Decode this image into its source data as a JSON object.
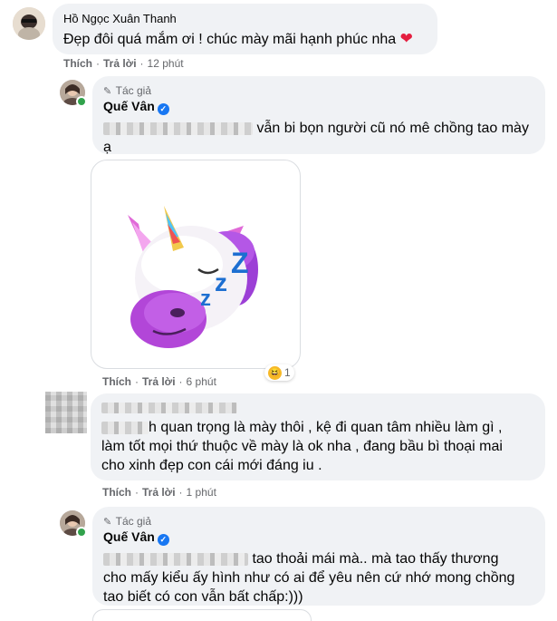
{
  "comments": [
    {
      "author": "Hồ Ngọc Xuân Thanh",
      "text": "Đẹp đôi quá mắm ơi ! chúc mày mãi hạnh phúc nha",
      "heart_icon": "red-heart-icon",
      "like": "Thích",
      "reply": "Trả lời",
      "time": "12 phút"
    },
    {
      "role": "Tác giả",
      "author": "Quế Vân",
      "text_visible": "vẫn bi bọn người cũ nó mê chồng tao mày",
      "text_line2": "ạ",
      "like": "Thích",
      "reply": "Trả lời",
      "time": "6 phút",
      "sticker": "sleeping-unicorn-sticker",
      "reaction_count": "1",
      "reaction_icon": "haha-reaction-icon"
    },
    {
      "text_line1_visible": "h quan trọng là mày thôi , kệ đi quan tâm nhiều làm gì ,",
      "text_line2": "làm tốt mọi thứ thuộc về mày là ok nha , đang bầu bì thoại mai",
      "text_line3": "cho xinh đẹp con cái mới đáng iu .",
      "like": "Thích",
      "reply": "Trả lời",
      "time": "1 phút"
    },
    {
      "role": "Tác giả",
      "author": "Quế Vân",
      "text_line1_visible": "tao thoải mái mà.. mà tao thấy thương",
      "text_line2": "cho mấy kiểu ấy hình như có ai để yêu nên cứ nhớ mong chồng",
      "text_line3": "tao biết có con vẫn bất chấp:)))"
    }
  ],
  "colors": {
    "bubble": "#f0f2f5",
    "secondary_text": "#65676b",
    "verified": "#1877f2",
    "heart": "#e41e3f"
  }
}
